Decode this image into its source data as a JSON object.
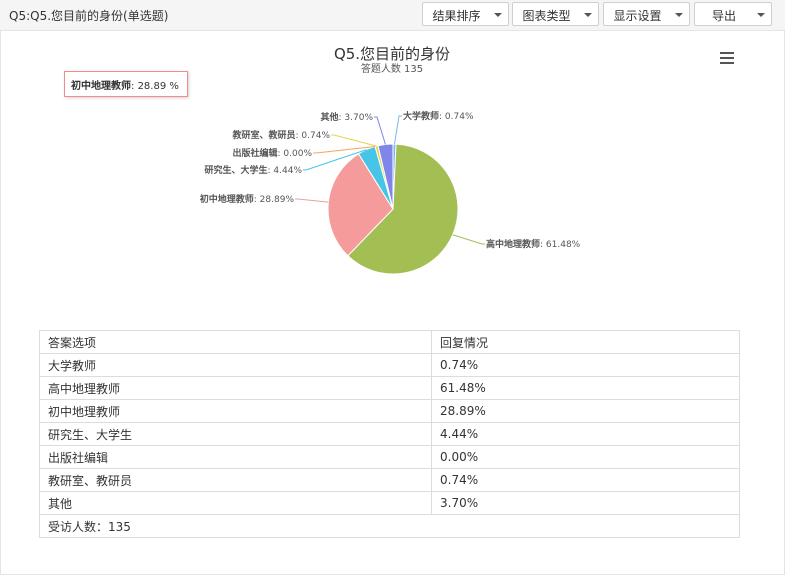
{
  "header": {
    "question_title": "Q5:Q5.您目前的身份(单选题)",
    "buttons": [
      "结果排序",
      "图表类型",
      "显示设置",
      "导出"
    ]
  },
  "tooltip": {
    "label": "初中地理教师",
    "value": "28.89 %"
  },
  "chart_data": {
    "type": "pie",
    "title": "Q5.您目前的身份",
    "subtitle": "答题人数 135",
    "slices": [
      {
        "label": "大学教师",
        "value": 0.74,
        "display": "0.74%",
        "color": "#7cb5ec"
      },
      {
        "label": "高中地理教师",
        "value": 61.48,
        "display": "61.48%",
        "color": "#a3bf54"
      },
      {
        "label": "初中地理教师",
        "value": 28.89,
        "display": "28.89%",
        "color": "#f59b9b"
      },
      {
        "label": "研究生、大学生",
        "value": 4.44,
        "display": "4.44%",
        "color": "#46c5e6"
      },
      {
        "label": "出版社编辑",
        "value": 0.0,
        "display": "0.00%",
        "color": "#f7a35c"
      },
      {
        "label": "教研室、教研员",
        "value": 0.74,
        "display": "0.74%",
        "color": "#e6d54b"
      },
      {
        "label": "其他",
        "value": 3.7,
        "display": "3.70%",
        "color": "#8085e9"
      }
    ]
  },
  "table": {
    "headers": [
      "答案选项",
      "回复情况"
    ],
    "rows": [
      [
        "大学教师",
        "0.74%"
      ],
      [
        "高中地理教师",
        "61.48%"
      ],
      [
        "初中地理教师",
        "28.89%"
      ],
      [
        "研究生、大学生",
        "4.44%"
      ],
      [
        "出版社编辑",
        "0.00%"
      ],
      [
        "教研室、教研员",
        "0.74%"
      ],
      [
        "其他",
        "3.70%"
      ]
    ],
    "footer": "受访人数：135"
  }
}
